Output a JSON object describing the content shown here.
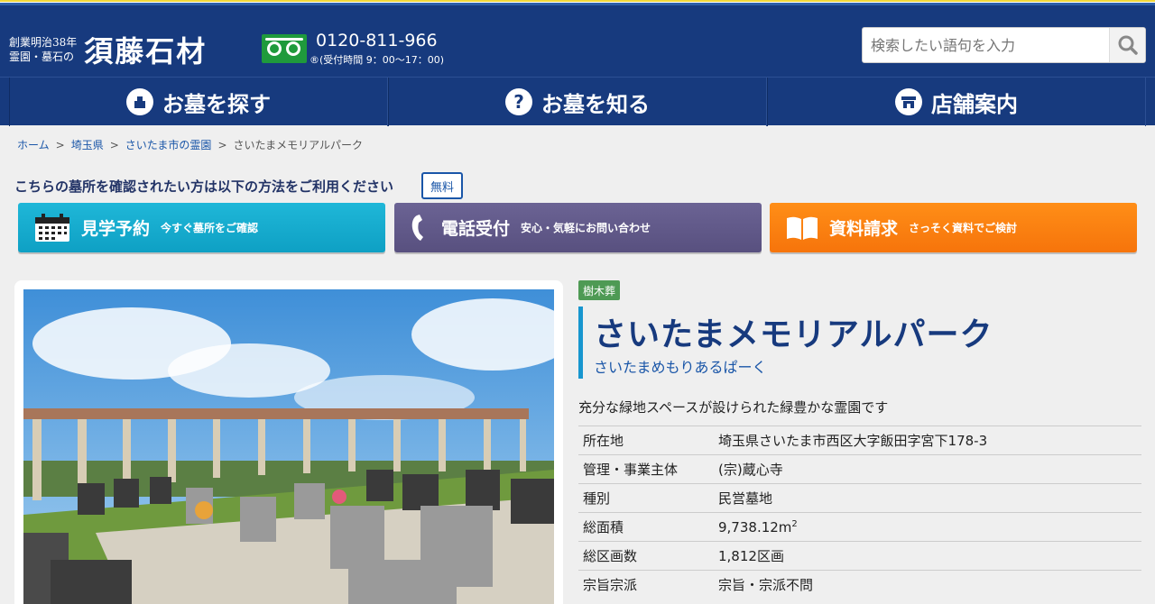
{
  "header": {
    "logo_small_line1": "創業明治38年",
    "logo_small_line2": "霊園・墓石の",
    "logo_main": "須藤石材",
    "phone": "0120-811-966",
    "hours": "®(受付時間 9：00〜17：00)",
    "search_placeholder": "検索したい語句を入力"
  },
  "nav": {
    "items": [
      {
        "label": "お墓を探す",
        "icon": "house-icon"
      },
      {
        "label": "お墓を知る",
        "icon": "question-icon"
      },
      {
        "label": "店舗案内",
        "icon": "shop-icon"
      }
    ]
  },
  "breadcrumb": {
    "items": [
      "ホーム",
      "埼玉県",
      "さいたま市の霊園"
    ],
    "current": "さいたまメモリアルパーク",
    "separator": ">"
  },
  "notice": {
    "text": "こちらの墓所を確認されたい方は以下の方法をご利用ください",
    "badge": "無料"
  },
  "cta": [
    {
      "title": "見学予約",
      "sub": "今すぐ墓所をご確認",
      "icon": "calendar-icon",
      "color": "#14abd0"
    },
    {
      "title": "電話受付",
      "sub": "安心・気軽にお問い合わせ",
      "icon": "phone-icon",
      "color": "#615a8a"
    },
    {
      "title": "資料請求",
      "sub": "さっそく資料でご検討",
      "icon": "book-icon",
      "color": "#fa8110"
    }
  ],
  "cemetery": {
    "tag": "樹木葬",
    "name": "さいたまメモリアルパーク",
    "reading": "さいたまめもりあるぱーく",
    "description": "充分な緑地スペースが設けられた緑豊かな霊園です",
    "details": [
      {
        "key": "所在地",
        "value": "埼玉県さいたま市西区大字飯田字宮下178-3"
      },
      {
        "key": "管理・事業主体",
        "value": "(宗)蔵心寺"
      },
      {
        "key": "種別",
        "value": "民営墓地"
      },
      {
        "key": "総面積",
        "value": "9,738.12m",
        "sup": "2"
      },
      {
        "key": "総区画数",
        "value": "1,812区画"
      },
      {
        "key": "宗旨宗派",
        "value": "宗旨・宗派不問"
      }
    ]
  },
  "colors": {
    "header_bg": "#173a7e",
    "accent_blue": "#1a56a8",
    "title_bar": "#1796cf",
    "tag_green": "#4e9a54"
  }
}
